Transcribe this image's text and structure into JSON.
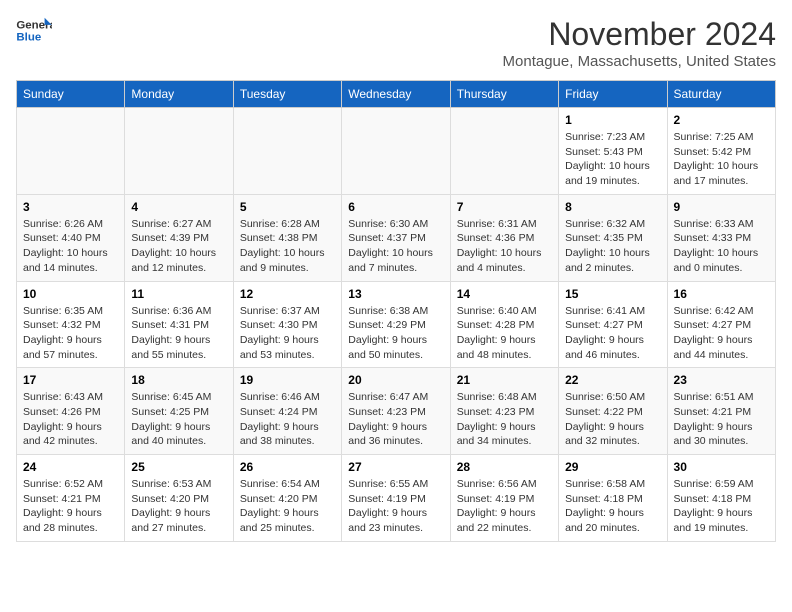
{
  "logo": {
    "line1": "General",
    "line2": "Blue"
  },
  "title": "November 2024",
  "location": "Montague, Massachusetts, United States",
  "days_of_week": [
    "Sunday",
    "Monday",
    "Tuesday",
    "Wednesday",
    "Thursday",
    "Friday",
    "Saturday"
  ],
  "weeks": [
    [
      {
        "day": "",
        "info": ""
      },
      {
        "day": "",
        "info": ""
      },
      {
        "day": "",
        "info": ""
      },
      {
        "day": "",
        "info": ""
      },
      {
        "day": "",
        "info": ""
      },
      {
        "day": "1",
        "info": "Sunrise: 7:23 AM\nSunset: 5:43 PM\nDaylight: 10 hours and 19 minutes."
      },
      {
        "day": "2",
        "info": "Sunrise: 7:25 AM\nSunset: 5:42 PM\nDaylight: 10 hours and 17 minutes."
      }
    ],
    [
      {
        "day": "3",
        "info": "Sunrise: 6:26 AM\nSunset: 4:40 PM\nDaylight: 10 hours and 14 minutes."
      },
      {
        "day": "4",
        "info": "Sunrise: 6:27 AM\nSunset: 4:39 PM\nDaylight: 10 hours and 12 minutes."
      },
      {
        "day": "5",
        "info": "Sunrise: 6:28 AM\nSunset: 4:38 PM\nDaylight: 10 hours and 9 minutes."
      },
      {
        "day": "6",
        "info": "Sunrise: 6:30 AM\nSunset: 4:37 PM\nDaylight: 10 hours and 7 minutes."
      },
      {
        "day": "7",
        "info": "Sunrise: 6:31 AM\nSunset: 4:36 PM\nDaylight: 10 hours and 4 minutes."
      },
      {
        "day": "8",
        "info": "Sunrise: 6:32 AM\nSunset: 4:35 PM\nDaylight: 10 hours and 2 minutes."
      },
      {
        "day": "9",
        "info": "Sunrise: 6:33 AM\nSunset: 4:33 PM\nDaylight: 10 hours and 0 minutes."
      }
    ],
    [
      {
        "day": "10",
        "info": "Sunrise: 6:35 AM\nSunset: 4:32 PM\nDaylight: 9 hours and 57 minutes."
      },
      {
        "day": "11",
        "info": "Sunrise: 6:36 AM\nSunset: 4:31 PM\nDaylight: 9 hours and 55 minutes."
      },
      {
        "day": "12",
        "info": "Sunrise: 6:37 AM\nSunset: 4:30 PM\nDaylight: 9 hours and 53 minutes."
      },
      {
        "day": "13",
        "info": "Sunrise: 6:38 AM\nSunset: 4:29 PM\nDaylight: 9 hours and 50 minutes."
      },
      {
        "day": "14",
        "info": "Sunrise: 6:40 AM\nSunset: 4:28 PM\nDaylight: 9 hours and 48 minutes."
      },
      {
        "day": "15",
        "info": "Sunrise: 6:41 AM\nSunset: 4:27 PM\nDaylight: 9 hours and 46 minutes."
      },
      {
        "day": "16",
        "info": "Sunrise: 6:42 AM\nSunset: 4:27 PM\nDaylight: 9 hours and 44 minutes."
      }
    ],
    [
      {
        "day": "17",
        "info": "Sunrise: 6:43 AM\nSunset: 4:26 PM\nDaylight: 9 hours and 42 minutes."
      },
      {
        "day": "18",
        "info": "Sunrise: 6:45 AM\nSunset: 4:25 PM\nDaylight: 9 hours and 40 minutes."
      },
      {
        "day": "19",
        "info": "Sunrise: 6:46 AM\nSunset: 4:24 PM\nDaylight: 9 hours and 38 minutes."
      },
      {
        "day": "20",
        "info": "Sunrise: 6:47 AM\nSunset: 4:23 PM\nDaylight: 9 hours and 36 minutes."
      },
      {
        "day": "21",
        "info": "Sunrise: 6:48 AM\nSunset: 4:23 PM\nDaylight: 9 hours and 34 minutes."
      },
      {
        "day": "22",
        "info": "Sunrise: 6:50 AM\nSunset: 4:22 PM\nDaylight: 9 hours and 32 minutes."
      },
      {
        "day": "23",
        "info": "Sunrise: 6:51 AM\nSunset: 4:21 PM\nDaylight: 9 hours and 30 minutes."
      }
    ],
    [
      {
        "day": "24",
        "info": "Sunrise: 6:52 AM\nSunset: 4:21 PM\nDaylight: 9 hours and 28 minutes."
      },
      {
        "day": "25",
        "info": "Sunrise: 6:53 AM\nSunset: 4:20 PM\nDaylight: 9 hours and 27 minutes."
      },
      {
        "day": "26",
        "info": "Sunrise: 6:54 AM\nSunset: 4:20 PM\nDaylight: 9 hours and 25 minutes."
      },
      {
        "day": "27",
        "info": "Sunrise: 6:55 AM\nSunset: 4:19 PM\nDaylight: 9 hours and 23 minutes."
      },
      {
        "day": "28",
        "info": "Sunrise: 6:56 AM\nSunset: 4:19 PM\nDaylight: 9 hours and 22 minutes."
      },
      {
        "day": "29",
        "info": "Sunrise: 6:58 AM\nSunset: 4:18 PM\nDaylight: 9 hours and 20 minutes."
      },
      {
        "day": "30",
        "info": "Sunrise: 6:59 AM\nSunset: 4:18 PM\nDaylight: 9 hours and 19 minutes."
      }
    ]
  ]
}
